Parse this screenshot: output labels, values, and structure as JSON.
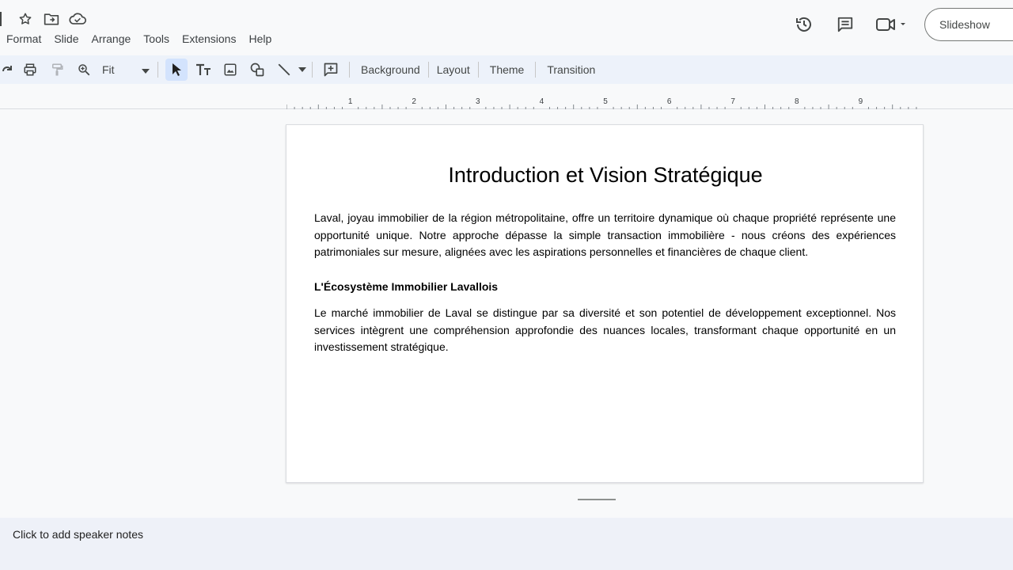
{
  "title_icons": [
    "star-icon",
    "move-to-folder-icon",
    "cloud-saved-icon"
  ],
  "menu": [
    "Format",
    "Slide",
    "Arrange",
    "Tools",
    "Extensions",
    "Help"
  ],
  "header_actions": {
    "icons": [
      "history-icon",
      "comment-icon",
      "video-call-icon"
    ],
    "slideshow_label": "Slideshow"
  },
  "toolbar": {
    "zoom_value": "Fit",
    "buttons": [
      "Background",
      "Layout",
      "Theme",
      "Transition"
    ]
  },
  "ruler": {
    "numbers": [
      "1",
      "2",
      "3",
      "4",
      "5",
      "6",
      "7",
      "8",
      "9"
    ]
  },
  "slide": {
    "title": "Introduction et Vision Stratégique",
    "paragraph1": "Laval, joyau immobilier de la région métropolitaine, offre un territoire dynamique où chaque propriété représente une opportunité unique. Notre approche dépasse la simple transaction immobilière - nous créons des expériences patrimoniales sur mesure, alignées avec les aspirations personnelles et financières de chaque client.",
    "subheading": "L'Écosystème Immobilier Lavallois",
    "paragraph2": "Le marché immobilier de Laval se distingue par sa diversité et son potentiel de développement exceptionnel. Nos services intègrent une compréhension approfondie des nuances locales, transformant chaque opportunité en un investissement stratégique."
  },
  "notes": {
    "placeholder": "Click to add speaker notes"
  },
  "colors": {
    "toolbar_bg": "#edf2fa",
    "active_tool": "#d3e3fd",
    "notes_bg": "#eef1f8"
  }
}
